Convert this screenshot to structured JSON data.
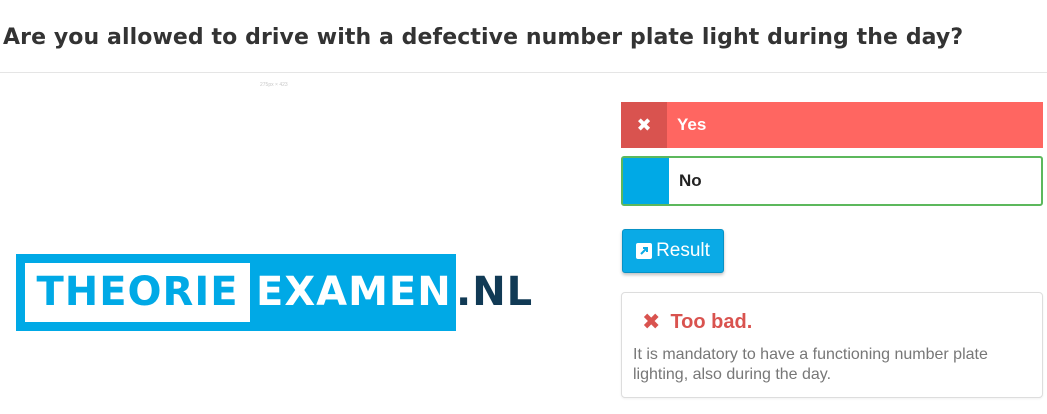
{
  "question": "Are you allowed to drive with a defective number plate light during the day?",
  "image_label": "275px × 423",
  "logo": {
    "part1": "THEORIE",
    "part2": "EXAMEN",
    "part3": ".NL"
  },
  "answers": [
    {
      "label": "Yes",
      "icon": "close-icon",
      "state": "wrong-selected",
      "color": "#ff6661"
    },
    {
      "label": "No",
      "icon": "",
      "state": "correct",
      "color": "#5cb85c"
    }
  ],
  "result_button": {
    "label": "Result",
    "icon": "external-link-icon",
    "color": "#0aaae6"
  },
  "feedback": {
    "title": "Too bad.",
    "icon": "close-icon",
    "text": "It is mandatory to have a functioning number plate lighting, also during the day."
  },
  "colors": {
    "brand_blue": "#00a9e6",
    "brand_dark": "#113a55",
    "wrong": "#d9534f",
    "correct_border": "#5cb85c"
  }
}
